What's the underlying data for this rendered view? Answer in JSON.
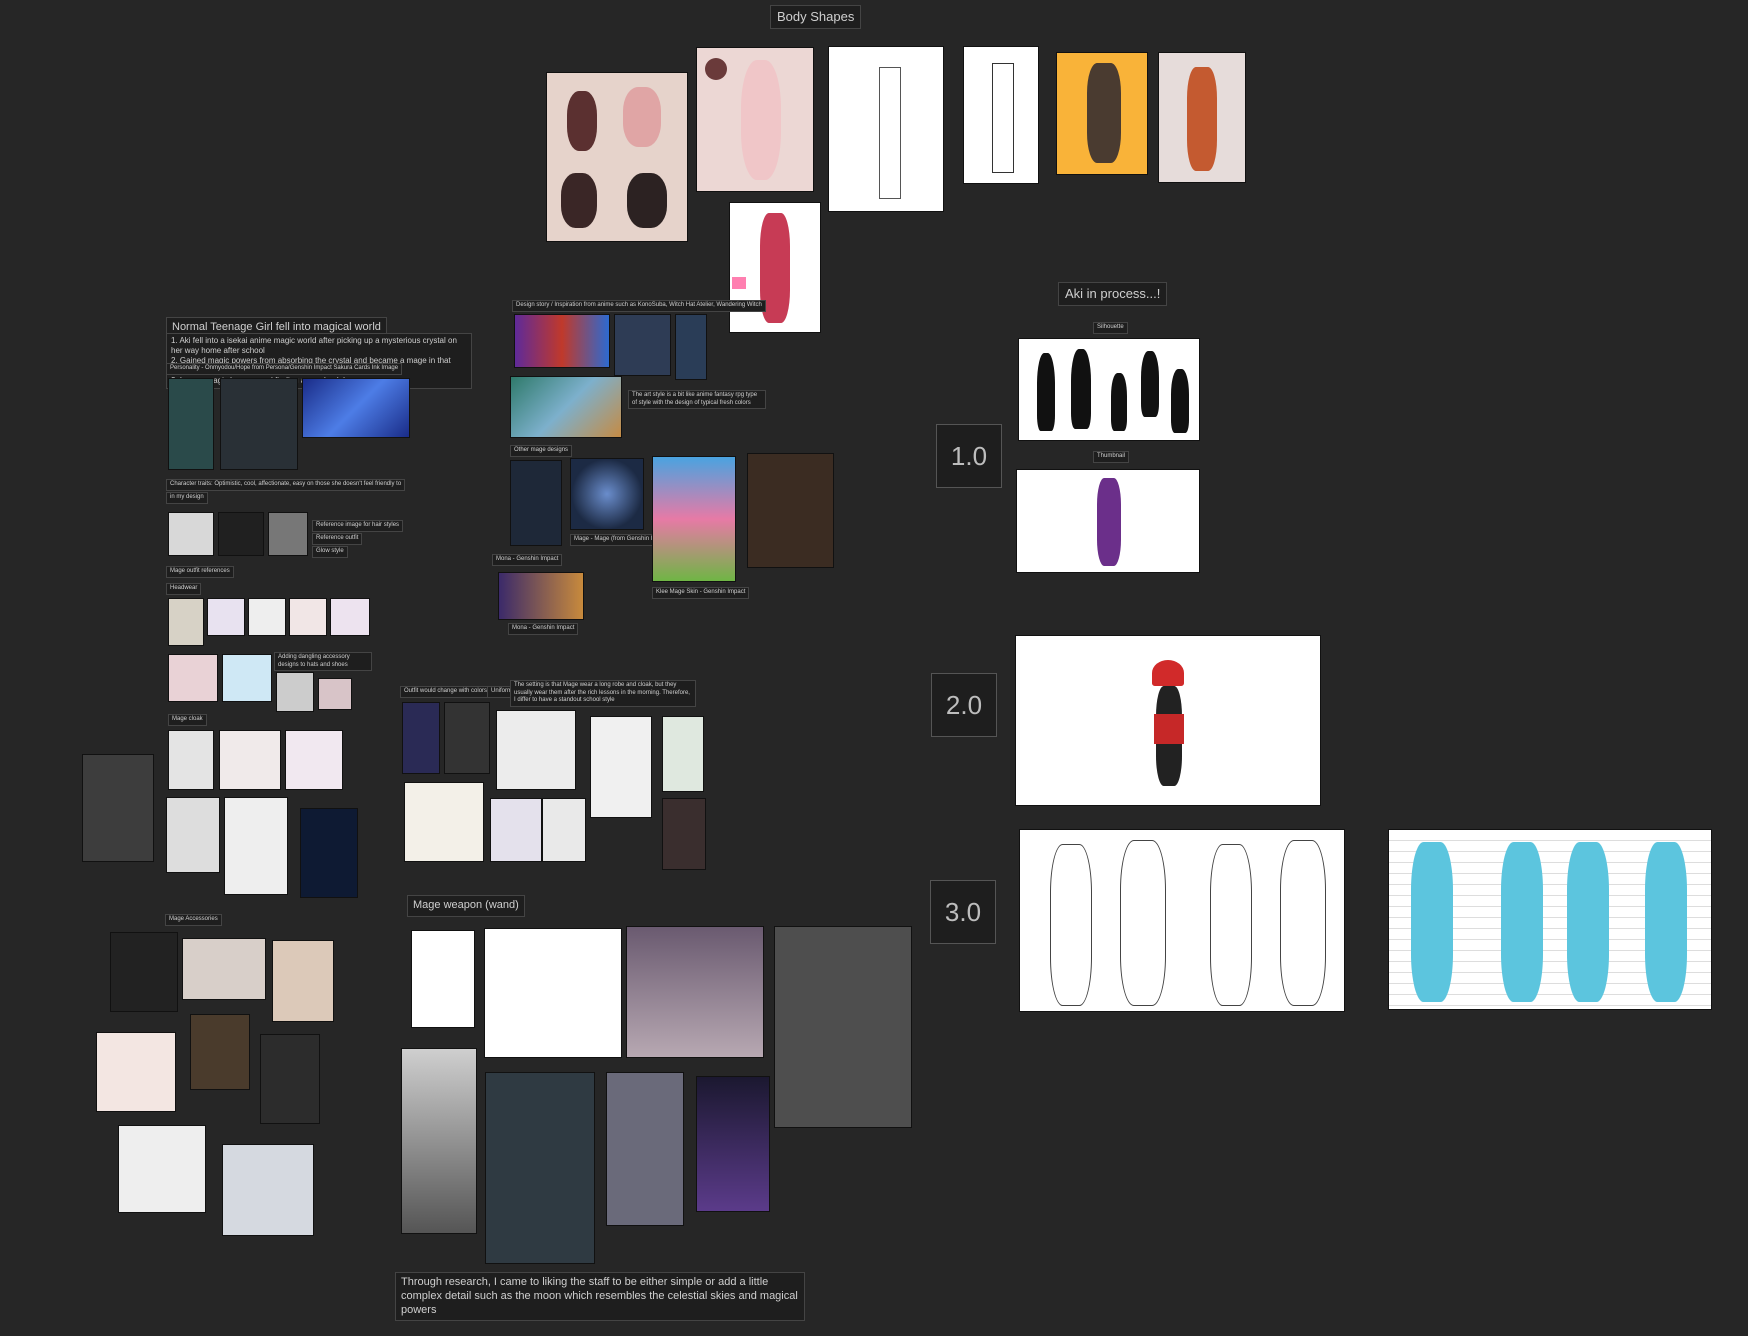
{
  "board": {
    "title": "Body Shapes",
    "process_title": "Aki in process...!",
    "silhouette_label": "Silhouette",
    "thumbnail_label": "Thumbnail",
    "versions": [
      "1.0",
      "2.0",
      "3.0"
    ],
    "story_title": "Normal Teenage Girl fell into magical world",
    "story_text": "1. Aki fell into a isekai anime magic world after picking up a mysterious crystal on her way home after school\n2. Gained magic powers from absorbing the crystal and became a mage in that world\n3. Learns magic lessons and finding a way back home",
    "personality_label": "Personality - Onmyodou/Hope from Persona/Genshin Impact Sakura Cards Ink Image",
    "character_traits": "Character traits: Optimistic, cool, affectionate, easy on those she doesn't feel friendly to",
    "hair_ref": "in my design",
    "hair_notes": [
      "Reference image for hair styles",
      "Reference outfit",
      "Glow style"
    ],
    "mage_outfit": "Mage outfit references",
    "headwear": "Headwear",
    "accessory_note": "Adding dangling accessory designs to hats and shoes",
    "mage_cloak": "Mage cloak",
    "mage_accessories": "Mage Accessories",
    "design_note": "Design story / Inspiration from anime such as KonoSuba, Witch Hat Atelier, Wandering Witch",
    "art_style_note": "The art style is a bit like anime fantasy rpg type of style with the design of typical fresh colors",
    "other_mage_designs": "Other mage designs",
    "mona_1": "Mona - Genshin Impact",
    "mona_2": "Mona - Genshin Impact",
    "klee_caption": "Klee Mage Skin - Genshin Impact",
    "mage_caption": "Mage - Mage (from Genshin Impact)",
    "outfit_notes": "Outfit would change with colors",
    "outfit_small": "Uniform",
    "outfit_setting": "The setting is that Mage wear a long robe and cloak, but they usually wear them after the rich lessons in the morning. Therefore, I differ to have a standout school style",
    "weapon_label": "Mage weapon (wand)",
    "research_text": "Through research, I came to liking the staff to be either simple or add a little complex detail such as the moon which resembles the celestial skies and magical powers"
  }
}
